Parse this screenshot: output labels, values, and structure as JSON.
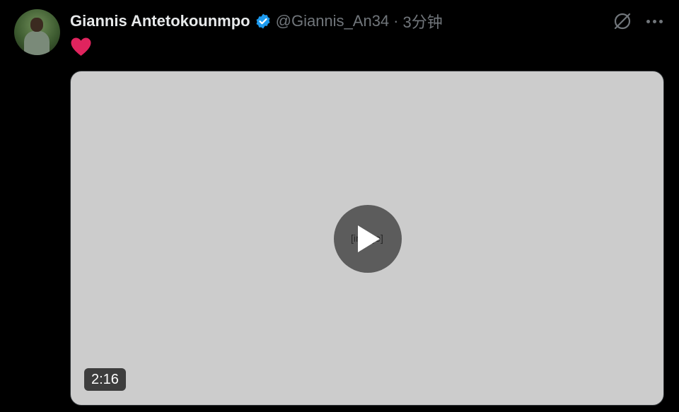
{
  "tweet": {
    "author_name": "Giannis Antetokounmpo",
    "handle": "@Giannis_An34",
    "separator": "·",
    "time": "3分钟",
    "verified": true,
    "icons": {
      "verified": "verified-badge-icon",
      "grok": "grok-icon",
      "more": "more-horizontal-icon",
      "heart": "red-heart-emoji",
      "play": "play-icon"
    },
    "colors": {
      "verified": "#1D9BF0",
      "heart": "#E0245E",
      "muted_text": "#71767b"
    }
  },
  "media": {
    "type": "video",
    "duration": "2:16"
  }
}
